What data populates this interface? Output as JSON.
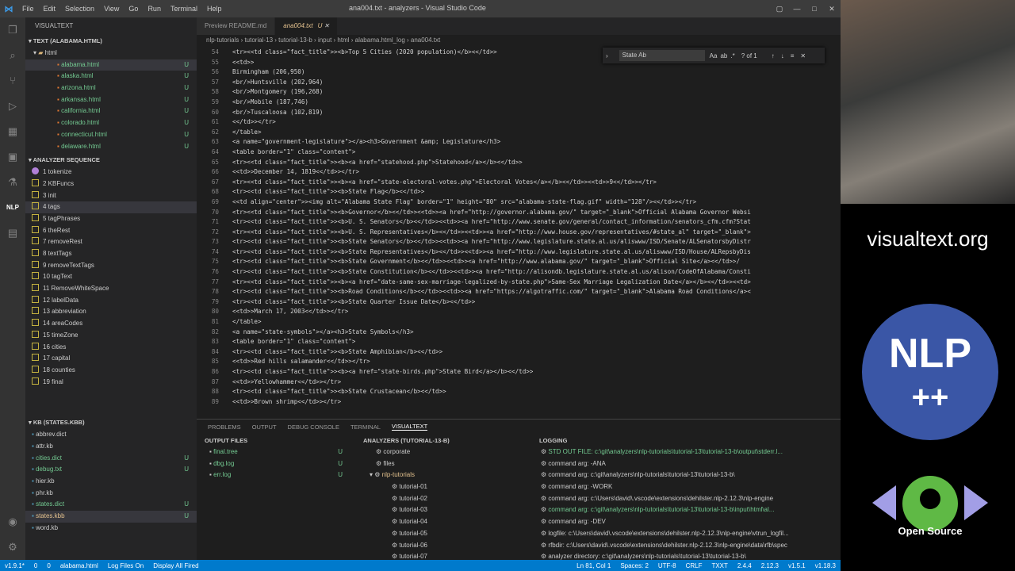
{
  "app": {
    "title": "ana004.txt - analyzers - Visual Studio Code",
    "menu": [
      "File",
      "Edit",
      "Selection",
      "View",
      "Go",
      "Run",
      "Terminal",
      "Help"
    ]
  },
  "sidebar": {
    "header": "VISUALTEXT",
    "text_section": "TEXT (ALABAMA.HTML)",
    "folder": "html",
    "files": [
      {
        "name": "alabama.html",
        "badge": "U"
      },
      {
        "name": "alaska.html",
        "badge": "U"
      },
      {
        "name": "arizona.html",
        "badge": "U"
      },
      {
        "name": "arkansas.html",
        "badge": "U"
      },
      {
        "name": "california.html",
        "badge": "U"
      },
      {
        "name": "colorado.html",
        "badge": "U"
      },
      {
        "name": "connecticut.html",
        "badge": "U"
      },
      {
        "name": "delaware.html",
        "badge": "U"
      }
    ],
    "seq_section": "ANALYZER SEQUENCE",
    "sequence": [
      "1 tokenize",
      "2 KBFuncs",
      "3 init",
      "4 tags",
      "5 tagPhrases",
      "6 theRest",
      "7 removeRest",
      "8 textTags",
      "9 removeTextTags",
      "10 tagText",
      "11 RemoveWhiteSpace",
      "12 labelData",
      "13 abbreviation",
      "14 areaCodes",
      "15 timeZone",
      "16 cities",
      "17 capital",
      "18 counties",
      "19 final"
    ],
    "kb_section": "KB (STATES.KBB)",
    "kb_files": [
      {
        "name": "abbrev.dict",
        "badge": ""
      },
      {
        "name": "attr.kb",
        "badge": ""
      },
      {
        "name": "cities.dict",
        "badge": "U"
      },
      {
        "name": "debug.txt",
        "badge": "U"
      },
      {
        "name": "hier.kb",
        "badge": ""
      },
      {
        "name": "phr.kb",
        "badge": ""
      },
      {
        "name": "states.dict",
        "badge": "U"
      },
      {
        "name": "states.kbb",
        "badge": "U"
      },
      {
        "name": "word.kb",
        "badge": ""
      }
    ]
  },
  "editor": {
    "tabs": [
      "Preview README.md",
      "ana004.txt"
    ],
    "active_tab_badge": "U",
    "breadcrumb": "nlp-tutorials › tutorial-13 › tutorial-13-b › input › html › alabama.html_log › ana004.txt",
    "find": {
      "value": "State Ab",
      "count": "? of 1"
    },
    "lines": [
      {
        "n": "54",
        "t": "<tr><<td class=\"fact_title\">><b>Top 5 Cities (2020 population)</b><</td>>"
      },
      {
        "n": "55",
        "t": "<<td>>"
      },
      {
        "n": "56",
        "t": "Birmingham (206,950)"
      },
      {
        "n": "57",
        "t": "<br/>Huntsville (202,964)"
      },
      {
        "n": "58",
        "t": "<br/>Montgomery (196,268)"
      },
      {
        "n": "59",
        "t": "<br/>Mobile (187,746)"
      },
      {
        "n": "60",
        "t": "<br/>Tuscaloosa (102,819)"
      },
      {
        "n": "61",
        "t": "<</td>></tr>"
      },
      {
        "n": "62",
        "t": "</table>"
      },
      {
        "n": "63",
        "t": "<a name=\"government-legislature\"></a><h3>Government &amp; Legislature</h3>"
      },
      {
        "n": "64",
        "t": "<table border=\"1\" class=\"content\">"
      },
      {
        "n": "65",
        "t": "<tr><<td class=\"fact_title\">><b><a href=\"statehood.php\">Statehood</a></b><</td>>"
      },
      {
        "n": "66",
        "t": "<<td>>December 14, 1819<</td>></tr>"
      },
      {
        "n": "67",
        "t": "<tr><<td class=\"fact_title\">><b><a href=\"state-electoral-votes.php\">Electoral Votes</a></b><</td>><<td>>9<</td>></tr>"
      },
      {
        "n": "68",
        "t": "<tr><<td class=\"fact_title\">><b>State Flag</b><</td>>"
      },
      {
        "n": "69",
        "t": "<<td align=\"center\">><img alt=\"Alabama State Flag\" border=\"1\" height=\"80\" src=\"alabama-state-flag.gif\" width=\"128\"/><</td>></tr>"
      },
      {
        "n": "70",
        "t": "<tr><<td class=\"fact_title\">><b>Governor</b><</td>><<td>><a href=\"http://governor.alabama.gov/\" target=\"_blank\">Official Alabama Governor Websi"
      },
      {
        "n": "71",
        "t": "<tr><<td class=\"fact_title\">><b>U. S. Senators</b><</td>><<td>><a href=\"http://www.senate.gov/general/contact_information/senators_cfm.cfm?Stat"
      },
      {
        "n": "72",
        "t": "<tr><<td class=\"fact_title\">><b>U. S. Representatives</b><</td>><<td>><a href=\"http://www.house.gov/representatives/#state_al\" target=\"_blank\">"
      },
      {
        "n": "73",
        "t": "<tr><<td class=\"fact_title\">><b>State Senators</b><</td>><<td>><a href=\"http://www.legislature.state.al.us/aliswww/ISD/Senate/ALSenatorsbyDistr"
      },
      {
        "n": "74",
        "t": "<tr><<td class=\"fact_title\">><b>State Representatives</b><</td>><<td>><a href=\"http://www.legislature.state.al.us/aliswww/ISD/House/ALRepsbyDis"
      },
      {
        "n": "75",
        "t": "<tr><<td class=\"fact_title\">><b>State Government</b><</td>><<td>><a href=\"http://www.alabama.gov/\" target=\"_blank\">Official Site</a><</td>>/"
      },
      {
        "n": "76",
        "t": "<tr><<td class=\"fact_title\">><b>State Constitution</b><</td>><<td>><a href=\"http://alisondb.legislature.state.al.us/alison/CodeOfAlabama/Consti"
      },
      {
        "n": "77",
        "t": "<tr><<td class=\"fact_title\">><b><a href=\"date-same-sex-marriage-legalized-by-state.php\">Same-Sex Marriage Legalization Date</a></b><</td>><<td>"
      },
      {
        "n": "78",
        "t": "<tr><<td class=\"fact_title\">><b>Road Conditions</b><</td>><<td>><a href=\"https://algotraffic.com/\" target=\"_blank\">Alabama Road Conditions</a><"
      },
      {
        "n": "79",
        "t": "<tr><<td class=\"fact_title\">><b>State Quarter Issue Date</b><</td>>"
      },
      {
        "n": "80",
        "t": "<<td>>March 17, 2003<</td>></tr>"
      },
      {
        "n": "81",
        "t": "</table>"
      },
      {
        "n": "82",
        "t": "<a name=\"state-symbols\"></a><h3>State Symbols</h3>"
      },
      {
        "n": "83",
        "t": "<table border=\"1\" class=\"content\">"
      },
      {
        "n": "84",
        "t": "<tr><<td class=\"fact_title\">><b>State Amphibian</b><</td>>"
      },
      {
        "n": "85",
        "t": "<<td>>Red hills salamander<</td>></tr>"
      },
      {
        "n": "86",
        "t": "<tr><<td class=\"fact_title\">><b><a href=\"state-birds.php\">State Bird</a></b><</td>>"
      },
      {
        "n": "87",
        "t": "<<td>>Yellowhammer<</td>></tr>"
      },
      {
        "n": "88",
        "t": "<tr><<td class=\"fact_title\">><b>State Crustacean</b><</td>>"
      },
      {
        "n": "89",
        "t": "<<td>>Brown shrimp<</td>></tr>"
      }
    ]
  },
  "panel": {
    "tabs": [
      "PROBLEMS",
      "OUTPUT",
      "DEBUG CONSOLE",
      "TERMINAL",
      "VISUALTEXT"
    ],
    "output_files_header": "OUTPUT FILES",
    "output_files": [
      {
        "name": "final.tree",
        "badge": "U"
      },
      {
        "name": "dbg.log",
        "badge": "U"
      },
      {
        "name": "err.log",
        "badge": "U"
      }
    ],
    "analyzers_header": "ANALYZERS (TUTORIAL-13-B)",
    "analyzers": [
      "corporate",
      "files",
      "nlp-tutorials",
      "tutorial-01",
      "tutorial-02",
      "tutorial-03",
      "tutorial-04",
      "tutorial-05",
      "tutorial-06",
      "tutorial-07"
    ],
    "logging_header": "LOGGING",
    "logging": [
      "STD OUT FILE: c:\\git\\analyzers\\nlp-tutorials\\tutorial-13\\tutorial-13-b\\output\\stderr.l...",
      "command arg: -ANA",
      "command arg: c:\\git\\analyzers\\nlp-tutorials\\tutorial-13\\tutorial-13-b\\",
      "command arg: -WORK",
      "command arg: c:\\Users\\david\\.vscode\\extensions\\dehilster.nlp-2.12.3\\nlp-engine",
      "command arg: c:\\git\\analyzers\\nlp-tutorials\\tutorial-13\\tutorial-13-b\\input\\html\\al...",
      "command arg: -DEV",
      "logfile: c:\\Users\\david\\.vscode\\extensions\\dehilster.nlp-2.12.3\\nlp-engine\\vtrun_logfil...",
      "rfbdir: c:\\Users\\david\\.vscode\\extensions\\dehilster.nlp-2.12.3\\nlp-engine\\data\\rfb\\spec",
      "analyzer directory: c:\\git\\analyzers\\nlp-tutorials\\tutorial-13\\tutorial-13-b\\"
    ]
  },
  "status": {
    "items": [
      "v1.9.1*",
      "0",
      "0",
      "alabama.html",
      "Log Files On",
      "Display All Fired"
    ],
    "right": [
      "Ln 81, Col 1",
      "Spaces: 2",
      "UTF-8",
      "CRLF",
      "TXXT",
      "2.4.4",
      "2.12.3",
      "v1.5.1",
      "v1.18.3"
    ]
  },
  "branding": {
    "site": "visualtext.org",
    "logo_top": "NLP",
    "logo_bottom": "++",
    "open_source": "Open Source"
  }
}
